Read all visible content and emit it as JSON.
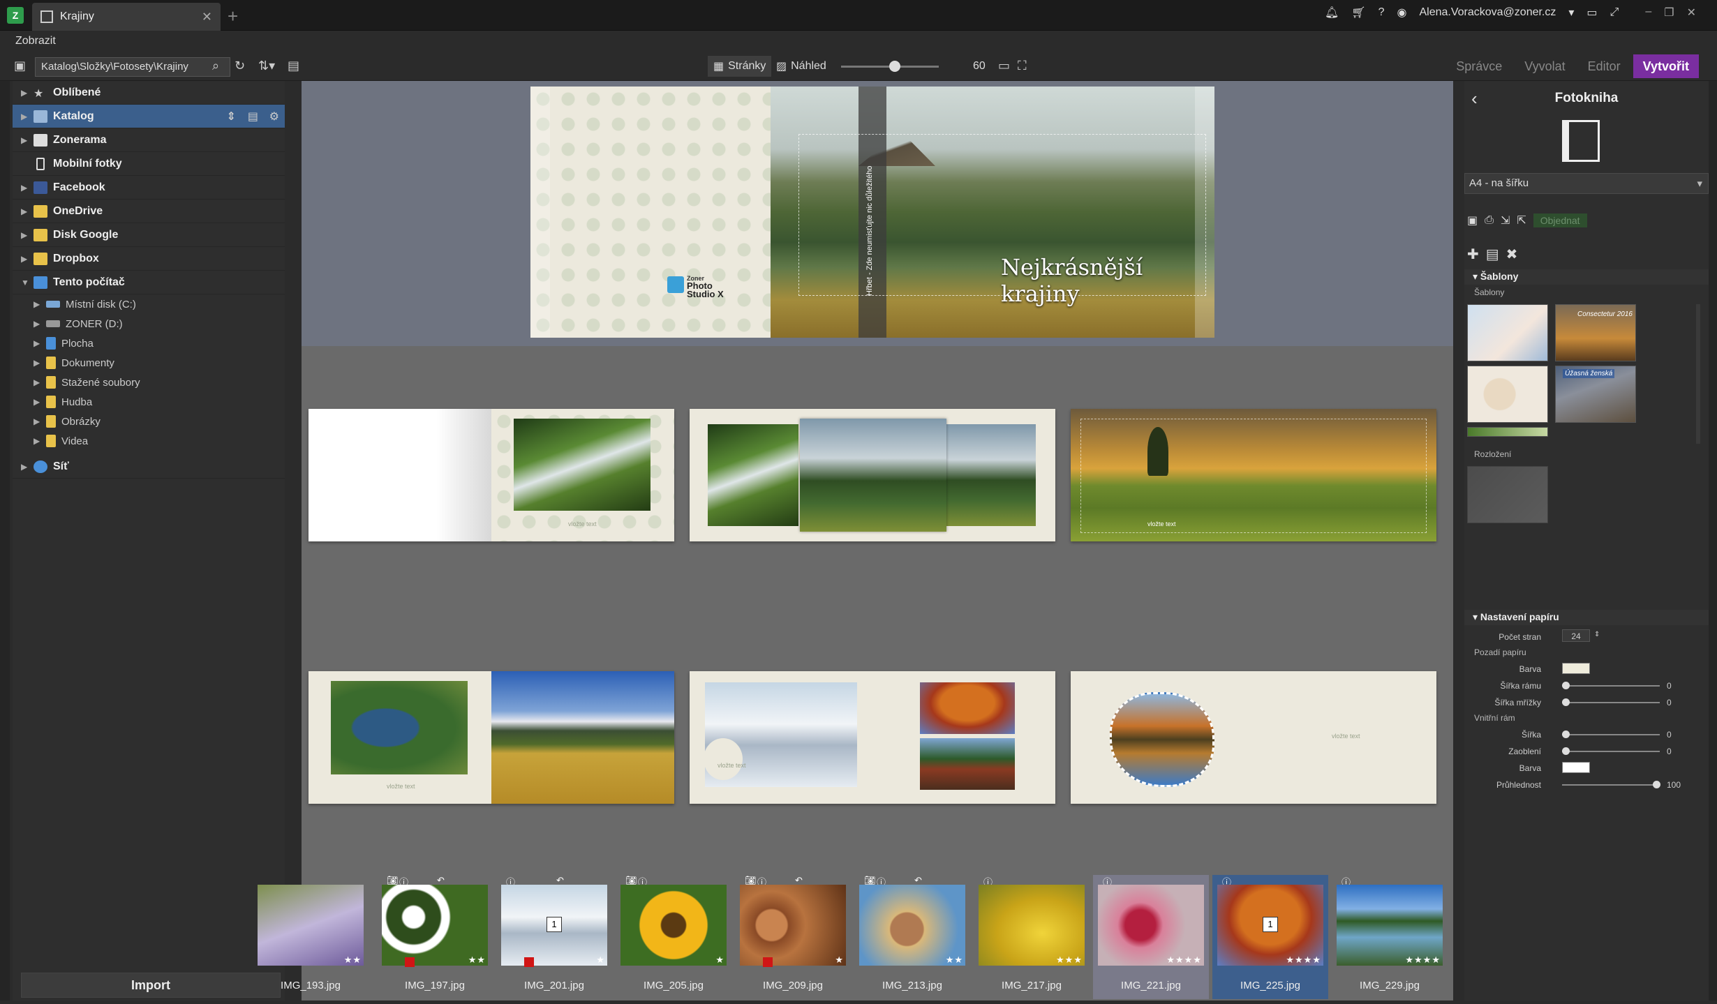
{
  "titlebar": {
    "app_logo": "Z",
    "tab_title": "Krajiny",
    "tab_close": "✕",
    "tab_add": "+",
    "user_email": "Alena.Vorackova@zoner.cz",
    "icons": [
      "bell-icon",
      "cart-icon",
      "help-icon",
      "user-icon",
      "monitor-icon",
      "fit-icon"
    ]
  },
  "menu": {
    "view": "Zobrazit"
  },
  "toolbar": {
    "path": "Katalog\\Složky\\Fotosety\\Krajiny",
    "pages_label": "Stránky",
    "preview_label": "Náhled",
    "zoom_value": "60",
    "zoom_level": 0.55,
    "modes": [
      "Správce",
      "Vyvolat",
      "Editor",
      "Vytvořit"
    ]
  },
  "sidebar": {
    "items": [
      {
        "label": "Oblíbené",
        "color": "#cccccc"
      },
      {
        "label": "Katalog",
        "color": "#9ab7d8"
      },
      {
        "label": "Zonerama",
        "color": "#dddddd"
      },
      {
        "label": "Mobilní fotky",
        "color": "#dddddd"
      },
      {
        "label": "Facebook",
        "color": "#3b5998"
      },
      {
        "label": "OneDrive",
        "color": "#e8c24a"
      },
      {
        "label": "Disk Google",
        "color": "#e8c24a"
      },
      {
        "label": "Dropbox",
        "color": "#e8c24a"
      },
      {
        "label": "Tento počítač",
        "color": "#4a90d9"
      }
    ],
    "computer_items": [
      "Místní disk (C:)",
      "ZONER (D:)",
      "Plocha",
      "Dokumenty",
      "Stažené soubory",
      "Hudba",
      "Obrázky",
      "Videa"
    ],
    "network": "Síť",
    "import_label": "Import"
  },
  "cover": {
    "title": "Nejkrásnější krajiny",
    "spine": "Hřbet - Zde neumisťujte nic důležitého",
    "logo_line1": "Zoner",
    "logo_line2": "Photo Studio X"
  },
  "spreads": {
    "text_placeholder": "vložte text"
  },
  "filmstrip": [
    {
      "name": "IMG_193.jpg",
      "stars": "★★",
      "flag": false
    },
    {
      "name": "IMG_197.jpg",
      "stars": "★★",
      "flag": true
    },
    {
      "name": "IMG_201.jpg",
      "stars": "★",
      "flag": true,
      "badge": "1"
    },
    {
      "name": "IMG_205.jpg",
      "stars": "★",
      "flag": false
    },
    {
      "name": "IMG_209.jpg",
      "stars": "★",
      "flag": true
    },
    {
      "name": "IMG_213.jpg",
      "stars": "★★",
      "flag": false
    },
    {
      "name": "IMG_217.jpg",
      "stars": "★★★",
      "flag": false
    },
    {
      "name": "IMG_221.jpg",
      "stars": "★★★★",
      "flag": false
    },
    {
      "name": "IMG_225.jpg",
      "stars": "★★★★",
      "flag": false,
      "badge": "1"
    },
    {
      "name": "IMG_229.jpg",
      "stars": "★★★★",
      "flag": false
    }
  ],
  "rightpanel": {
    "title": "Fotokniha",
    "format": "A4 - na šířku",
    "order_label": "Objednat",
    "templates_section": "Šablony",
    "templates_label": "Šablony",
    "layout_label": "Rozložení",
    "template_texts": [
      "Consectetur 2016",
      "Úžasná ženská"
    ],
    "paper_section": "Nastavení papíru",
    "page_count_label": "Počet stran",
    "page_count": "24",
    "paper_bg_label": "Pozadí papíru",
    "color_label": "Barva",
    "paper_color": "#efecdc",
    "frame_width_label": "Šířka rámu",
    "frame_width": "0",
    "grid_width_label": "Šířka mřížky",
    "grid_width": "0",
    "inner_frame_label": "Vnitřní rám",
    "inner_width_label": "Šířka",
    "inner_width": "0",
    "rounding_label": "Zaoblení",
    "rounding": "0",
    "inner_color_label": "Barva",
    "inner_color": "#ffffff",
    "opacity_label": "Průhlednost",
    "opacity": "100"
  },
  "colors": {
    "accent": "#7a2ea0",
    "selection": "#3b5f8c",
    "paper": "#ece9dd"
  }
}
